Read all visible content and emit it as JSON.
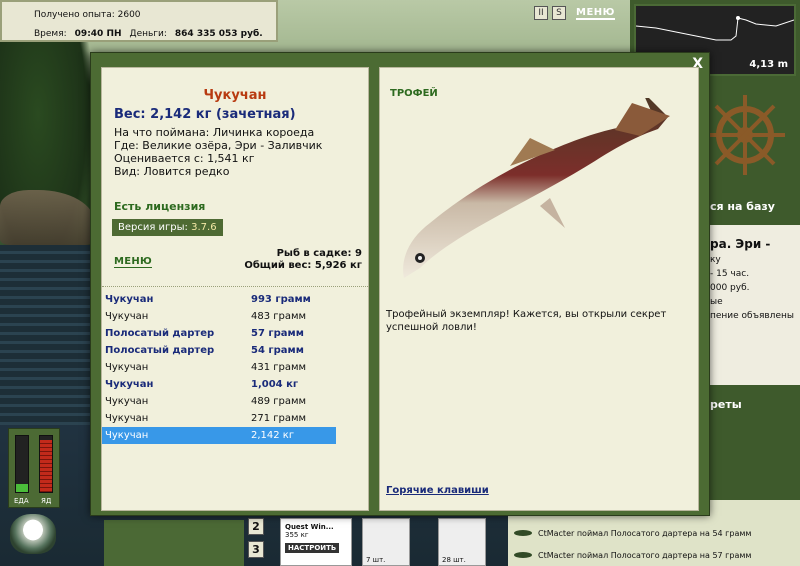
{
  "status": {
    "experience_label": "Получено опыта:",
    "experience_value": "2600",
    "time_label": "Время:",
    "time_value": "09:40 ПН",
    "money_label": "Деньги:",
    "money_value": "864 335 053 руб."
  },
  "topbar": {
    "pause_glyph": "II",
    "settings_glyph": "S",
    "menu_label": "МЕНЮ"
  },
  "minimap": {
    "depth": "4,13 m"
  },
  "side": {
    "go_base": "ся на базу",
    "lake_title": "ра. Эри -",
    "lake_line1": "ку",
    "lake_line2": "- 15 час.",
    "lake_line3": "000 руб.",
    "lake_line4": "ые",
    "lake_line5": "пение объявлены",
    "secrets": "реты"
  },
  "feed": [
    "CtMacter поймал Полосатого дартера на 54 грамм",
    "CtMacter поймал Полосатого дартера на 57 грамм"
  ],
  "gauges": {
    "energy_label": "ЕДА",
    "food_label": "ЯД",
    "energy_level": 0.14,
    "satiety_level": 0.9
  },
  "slots": [
    "2",
    "3"
  ],
  "quest": {
    "name": "Quest Win...",
    "weight": "355 кг",
    "setup": "НАСТРОИТЬ"
  },
  "baits": {
    "bait1_count": "7 шт.",
    "bait2_count": "28 шт."
  },
  "dialog": {
    "close": "X",
    "fish_name": "Чукучан",
    "weight_line": "Вес: 2,142 кг (зачетная)",
    "info": [
      "На что поймана: Личинка короеда",
      "Где: Великие озёра, Эри - Заливчик",
      "Оценивается с: 1,541 кг",
      "Вид: Ловится редко"
    ],
    "license": "Есть лицензия",
    "version_label": "Версия игры:",
    "version_value": "3.7.6",
    "menu": "МЕНЮ",
    "count_line": "Рыб в садке: 9",
    "total_line": "Общий вес: 5,926 кг",
    "catch": [
      {
        "name": "Чукучан",
        "weight": "993 грамм",
        "hl": true,
        "sel": false
      },
      {
        "name": "Чукучан",
        "weight": "483 грамм",
        "hl": false,
        "sel": false
      },
      {
        "name": "Полосатый дартер",
        "weight": "57 грамм",
        "hl": true,
        "sel": false
      },
      {
        "name": "Полосатый дартер",
        "weight": "54 грамм",
        "hl": true,
        "sel": false
      },
      {
        "name": "Чукучан",
        "weight": "431 грамм",
        "hl": false,
        "sel": false
      },
      {
        "name": "Чукучан",
        "weight": "1,004 кг",
        "hl": true,
        "sel": false
      },
      {
        "name": "Чукучан",
        "weight": "489 грамм",
        "hl": false,
        "sel": false
      },
      {
        "name": "Чукучан",
        "weight": "271 грамм",
        "hl": false,
        "sel": false
      },
      {
        "name": "Чукучан",
        "weight": "2,142 кг",
        "hl": false,
        "sel": true
      }
    ],
    "trophy_header": "ТРОФЕЙ",
    "trophy_text": "Трофейный экземпляр! Кажется, вы открыли секрет успешной ловли!",
    "hotkeys": "Горячие клавиши"
  }
}
